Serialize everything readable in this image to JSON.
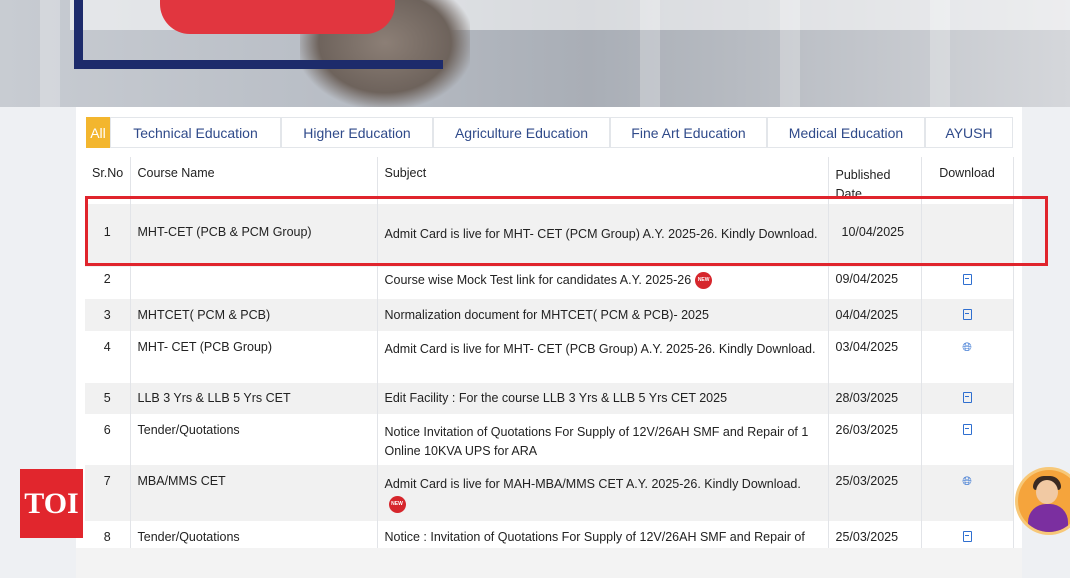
{
  "toi_logo": "TOI",
  "tabs": [
    {
      "label": "All",
      "active": true
    },
    {
      "label": "Technical Education",
      "active": false
    },
    {
      "label": "Higher Education",
      "active": false
    },
    {
      "label": "Agriculture Education",
      "active": false
    },
    {
      "label": "Fine Art Education",
      "active": false
    },
    {
      "label": "Medical Education",
      "active": false
    },
    {
      "label": "AYUSH",
      "active": false
    }
  ],
  "table": {
    "headers": {
      "srno": "Sr.No",
      "course": "Course Name",
      "subject": "Subject",
      "published": "Published Date",
      "download": "Download"
    },
    "rows": [
      {
        "srno": "1",
        "course": "MHT-CET (PCB & PCM Group)",
        "subject": "Admit Card is live for MHT- CET (PCM Group) A.Y. 2025-26. Kindly Download.",
        "date": "10/04/2025",
        "download_icon": "none",
        "bold": false,
        "new": false
      },
      {
        "srno": "2",
        "course": "",
        "subject": "Course wise Mock Test link for candidates A.Y. 2025-26",
        "date": "09/04/2025",
        "download_icon": "pdf-icon",
        "bold": false,
        "new": true
      },
      {
        "srno": "3",
        "course": "MHTCET( PCM & PCB)",
        "subject": "Normalization document for MHTCET( PCM & PCB)- 2025",
        "date": "04/04/2025",
        "download_icon": "pdf-icon",
        "bold": false,
        "new": false
      },
      {
        "srno": "4",
        "course": "MHT- CET (PCB Group)",
        "subject": "Admit Card is live for MHT- CET (PCB Group) A.Y. 2025-26. Kindly Download.",
        "date": "03/04/2025",
        "download_icon": "globe-icon",
        "bold": true,
        "new": false
      },
      {
        "srno": "5",
        "course": "LLB 3 Yrs & LLB 5 Yrs CET",
        "subject": "Edit Facility : For the course LLB 3 Yrs & LLB 5 Yrs CET 2025",
        "date": "28/03/2025",
        "download_icon": "pdf-icon",
        "bold": false,
        "new": false
      },
      {
        "srno": "6",
        "course": "Tender/Quotations",
        "subject": "Notice Invitation of Quotations For Supply of 12V/26AH SMF and Repair of 1 Online 10KVA UPS for ARA",
        "date": "26/03/2025",
        "download_icon": "pdf-icon",
        "bold": false,
        "new": false
      },
      {
        "srno": "7",
        "course": "MBA/MMS CET",
        "subject": "Admit Card is live for MAH-MBA/MMS CET A.Y. 2025-26. Kindly Download.",
        "date": "25/03/2025",
        "download_icon": "globe-icon",
        "bold": true,
        "new": true
      },
      {
        "srno": "8",
        "course": "Tender/Quotations",
        "subject": "Notice : Invitation of Quotations For Supply of 12V/26AH SMF and Repair of",
        "date": "25/03/2025",
        "download_icon": "pdf-icon",
        "bold": false,
        "new": false
      }
    ]
  },
  "new_badge_text": "NEW",
  "colors": {
    "accent": "#f3b62e",
    "link": "#2f4a8a",
    "highlight": "#e0242c",
    "brand_red": "#e1262d"
  }
}
